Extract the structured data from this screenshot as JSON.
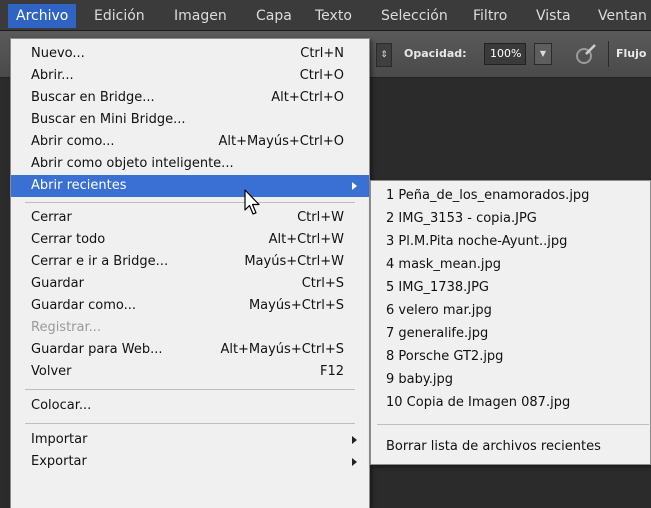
{
  "menubar": {
    "items": [
      {
        "label": "Archivo",
        "active": true
      },
      {
        "label": "Edición"
      },
      {
        "label": "Imagen"
      },
      {
        "label": "Capa"
      },
      {
        "label": "Texto"
      },
      {
        "label": "Selección"
      },
      {
        "label": "Filtro"
      },
      {
        "label": "Vista"
      },
      {
        "label": "Ventan"
      }
    ]
  },
  "options_bar": {
    "opacity_label": "Opacidad:",
    "opacity_value": "100%",
    "flow_label": "Flujo",
    "stepper_icon": "up-down-arrows-icon",
    "dropdown_icon": "chevron-down-icon",
    "airbrush_icon": "airbrush-icon"
  },
  "file_menu": {
    "items": [
      {
        "label": "Nuevo...",
        "shortcut": "Ctrl+N"
      },
      {
        "label": "Abrir...",
        "shortcut": "Ctrl+O"
      },
      {
        "label": "Buscar en Bridge...",
        "shortcut": "Alt+Ctrl+O"
      },
      {
        "label": "Buscar en Mini Bridge...",
        "shortcut": ""
      },
      {
        "label": "Abrir como...",
        "shortcut": "Alt+Mayús+Ctrl+O"
      },
      {
        "label": "Abrir como objeto inteligente...",
        "shortcut": ""
      },
      {
        "label": "Abrir recientes",
        "submenu": true,
        "highlighted": true
      },
      {
        "label": "Cerrar",
        "shortcut": "Ctrl+W"
      },
      {
        "label": "Cerrar todo",
        "shortcut": "Alt+Ctrl+W"
      },
      {
        "label": "Cerrar e ir a Bridge...",
        "shortcut": "Mayús+Ctrl+W"
      },
      {
        "label": "Guardar",
        "shortcut": "Ctrl+S"
      },
      {
        "label": "Guardar como...",
        "shortcut": "Mayús+Ctrl+S"
      },
      {
        "label": "Registrar...",
        "shortcut": "",
        "disabled": true
      },
      {
        "label": "Guardar para Web...",
        "shortcut": "Alt+Mayús+Ctrl+S"
      },
      {
        "label": "Volver",
        "shortcut": "F12"
      },
      {
        "label": "Colocar...",
        "shortcut": ""
      },
      {
        "label": "Importar",
        "submenu": true
      },
      {
        "label": "Exportar",
        "submenu": true
      }
    ]
  },
  "recent_menu": {
    "items": [
      "1 Peña_de_los_enamorados.jpg",
      "2 IMG_3153 - copia.JPG",
      "3 Pl.M.Pita noche-Ayunt..jpg",
      "4 mask_mean.jpg",
      "5 IMG_1738.JPG",
      "6 velero mar.jpg",
      "7 generalife.jpg",
      "8 Porsche GT2.jpg",
      "9 baby.jpg",
      "10 Copia de Imagen 087.jpg"
    ],
    "clear_label": "Borrar lista de archivos recientes"
  },
  "colors": {
    "menu_bg": "#f0f0f0",
    "highlight": "#3a6fd3",
    "menubar_active": "#2f64c4",
    "app_bg": "#2b2b2b"
  }
}
